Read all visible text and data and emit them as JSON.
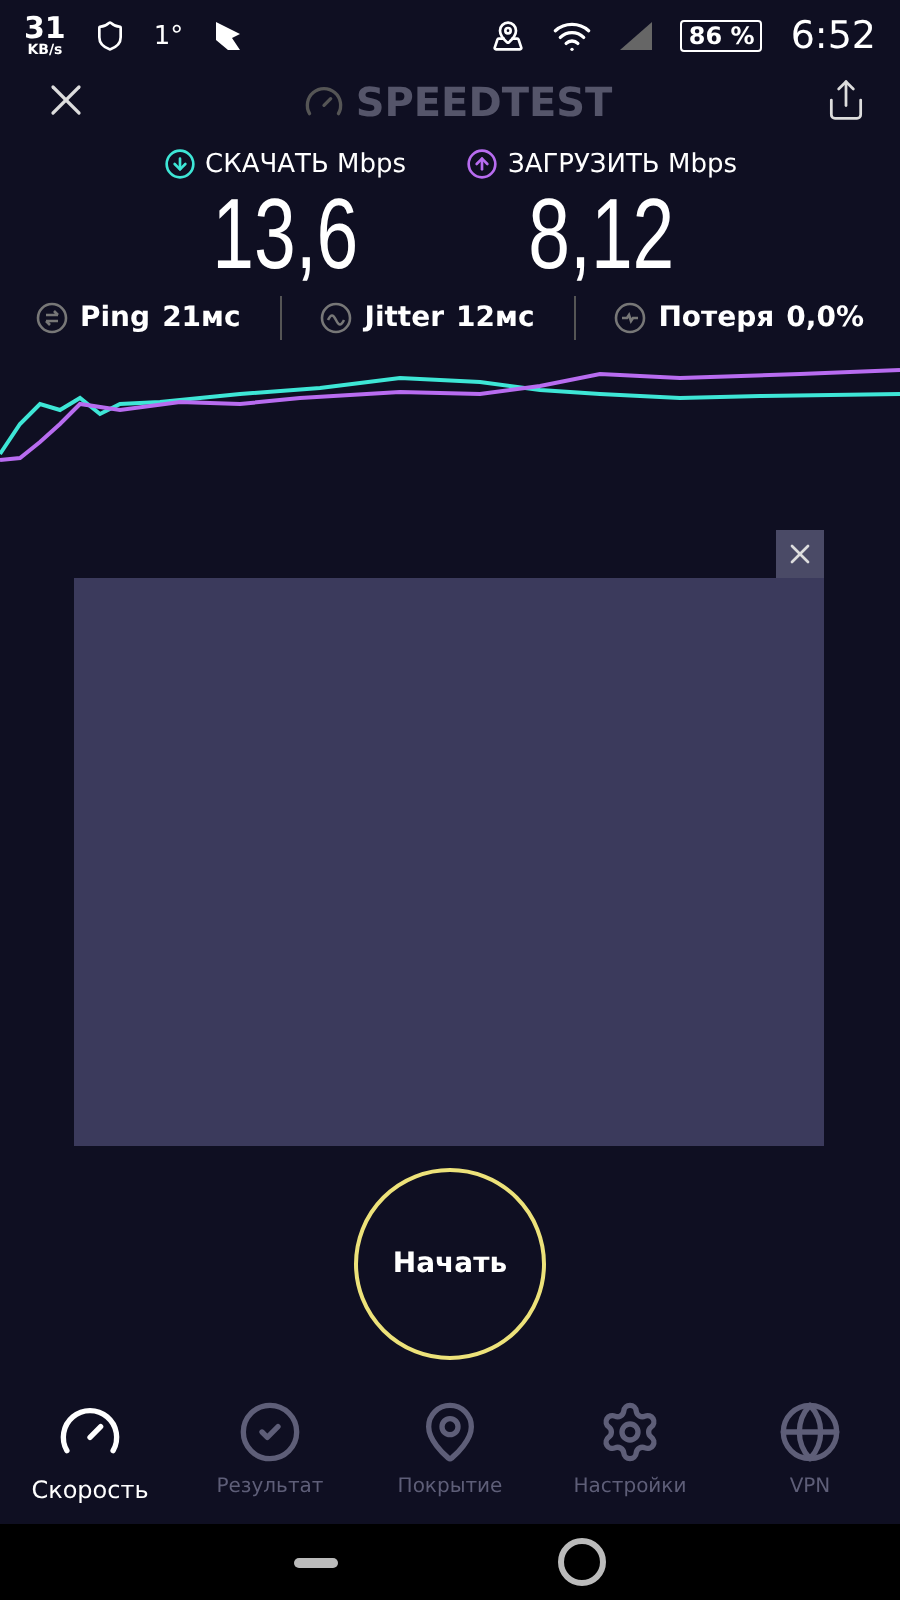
{
  "status_bar": {
    "net_speed": "31",
    "net_unit": "KB/s",
    "temperature": "1°",
    "battery": "86 %",
    "time": "6:52"
  },
  "header": {
    "title": "SPEEDTEST"
  },
  "results": [
    {
      "kind": "download",
      "label": "СКАЧАТЬ Mbps",
      "value": "13,6",
      "color": "#3ee6d6"
    },
    {
      "kind": "upload",
      "label": "ЗАГРУЗИТЬ Mbps",
      "value": "8,12",
      "color": "#b86cf0"
    }
  ],
  "stats": [
    {
      "kind": "ping",
      "label": "Ping",
      "value": "21мс"
    },
    {
      "kind": "jitter",
      "label": "Jitter",
      "value": "12мс"
    },
    {
      "kind": "loss",
      "label": "Потеря",
      "value": "0,0%"
    }
  ],
  "start_button": {
    "label": "Начать"
  },
  "tabs": [
    {
      "kind": "speed",
      "label": "Скорость",
      "selected": true
    },
    {
      "kind": "result",
      "label": "Результат",
      "selected": false
    },
    {
      "kind": "coverage",
      "label": "Покрытие",
      "selected": false
    },
    {
      "kind": "settings",
      "label": "Настройки",
      "selected": false
    },
    {
      "kind": "vpn",
      "label": "VPN",
      "selected": false
    }
  ]
}
